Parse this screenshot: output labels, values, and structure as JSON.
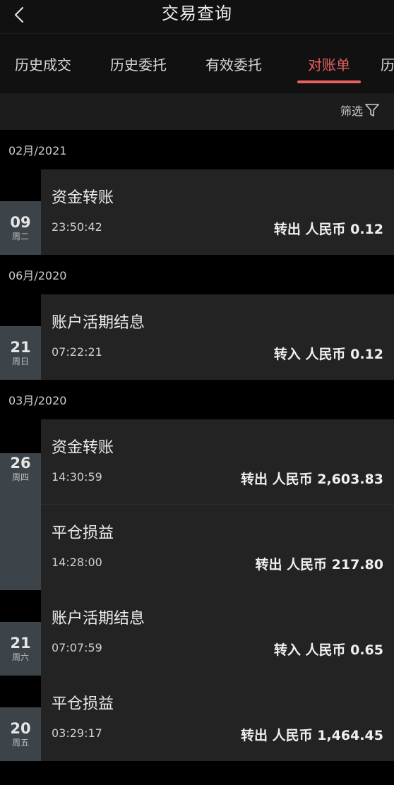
{
  "header": {
    "title": "交易查询"
  },
  "tabs": [
    {
      "label": "历史成交",
      "active": false
    },
    {
      "label": "历史委托",
      "active": false
    },
    {
      "label": "有效委托",
      "active": false
    },
    {
      "label": "对账单",
      "active": true
    },
    {
      "label": "历",
      "active": false
    }
  ],
  "filter": {
    "label": "筛选"
  },
  "colors": {
    "accent": "#e8615f",
    "day_box": "#3c4449",
    "card": "#232323"
  },
  "months": [
    {
      "label": "02月/2021",
      "days": [
        {
          "day": "09",
          "weekday": "周二",
          "entries": [
            {
              "title": "资金转账",
              "time": "23:50:42",
              "amount": "转出 人民币 0.12"
            }
          ]
        }
      ]
    },
    {
      "label": "06月/2020",
      "days": [
        {
          "day": "21",
          "weekday": "周日",
          "entries": [
            {
              "title": "账户活期结息",
              "time": "07:22:21",
              "amount": "转入 人民币 0.12"
            }
          ]
        }
      ]
    },
    {
      "label": "03月/2020",
      "days": [
        {
          "day": "26",
          "weekday": "周四",
          "entries": [
            {
              "title": "资金转账",
              "time": "14:30:59",
              "amount": "转出 人民币 2,603.83"
            },
            {
              "title": "平仓损益",
              "time": "14:28:00",
              "amount": "转出 人民币 217.80"
            }
          ]
        },
        {
          "day": "21",
          "weekday": "周六",
          "entries": [
            {
              "title": "账户活期结息",
              "time": "07:07:59",
              "amount": "转入 人民币 0.65"
            }
          ]
        },
        {
          "day": "20",
          "weekday": "周五",
          "entries": [
            {
              "title": "平仓损益",
              "time": "03:29:17",
              "amount": "转出 人民币 1,464.45"
            }
          ]
        }
      ]
    }
  ]
}
